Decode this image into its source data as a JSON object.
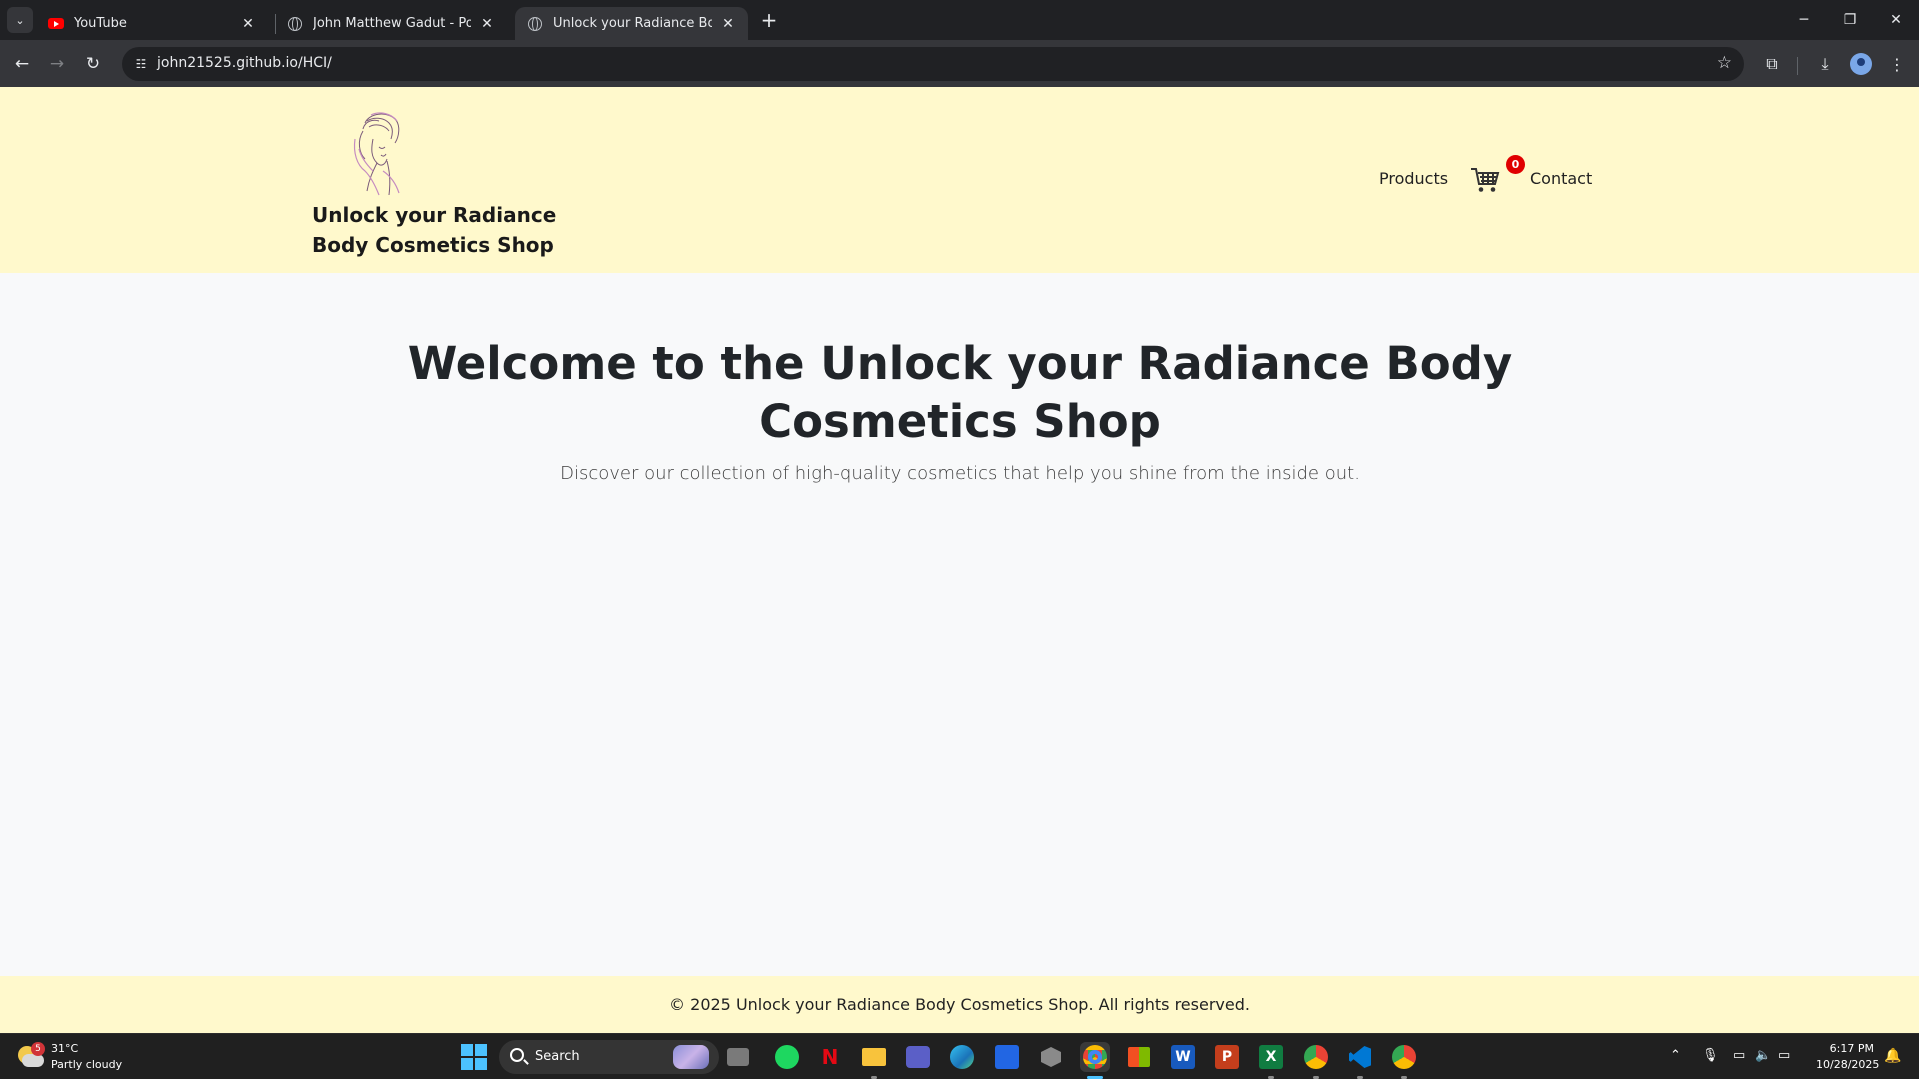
{
  "browser": {
    "tabs": [
      {
        "title": "YouTube",
        "icon": "youtube-icon",
        "active": false
      },
      {
        "title": "John Matthew Gadut - Portfolio",
        "icon": "globe-icon",
        "active": false
      },
      {
        "title": "Unlock your Radiance Body Ma",
        "icon": "globe-icon",
        "active": true
      }
    ],
    "url": "john21525.github.io/HCI/"
  },
  "site": {
    "brand": "Unlock your Radiance Body Cosmetics Shop",
    "nav": {
      "products": "Products",
      "cart_count": "0",
      "contact": "Contact"
    },
    "hero": {
      "title": "Welcome to the Unlock your Radiance Body Cosmetics Shop",
      "subtitle": "Discover our collection of high-quality cosmetics that help you shine from the inside out."
    },
    "footer": "© 2025 Unlock your Radiance Body Cosmetics Shop. All rights reserved.",
    "colors": {
      "header_bg": "#fff9cc",
      "page_bg": "#f8f9fa",
      "cart_badge": "#e00000"
    }
  },
  "taskbar": {
    "weather": {
      "temp": "31°C",
      "condition": "Partly cloudy",
      "badge": "5"
    },
    "search_label": "Search",
    "clock": {
      "time": "6:17 PM",
      "date": "10/28/2025"
    }
  }
}
